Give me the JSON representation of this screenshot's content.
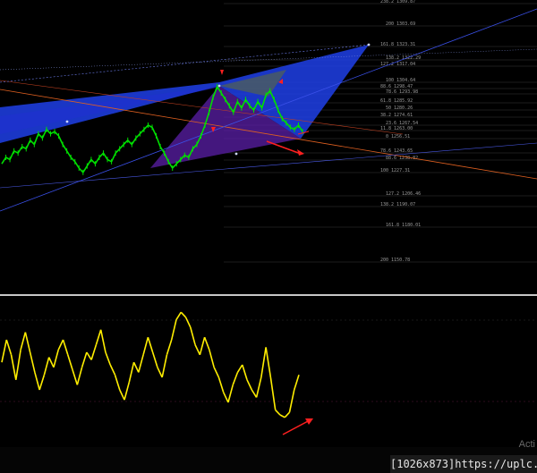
{
  "chart_data": [
    {
      "type": "line",
      "title": "",
      "xlabel": "",
      "ylabel": "",
      "ylim": [
        1140,
        1330
      ],
      "grid": false,
      "fib_levels": [
        {
          "label": "238.2 1309.87",
          "price": 1309.87
        },
        {
          "label": "200 1303.69",
          "price": 1303.69
        },
        {
          "label": "161.8 1323.31",
          "price": 1323.31
        },
        {
          "label": "138.2 1322.29",
          "price": 1322.29
        },
        {
          "label": "127.2 1317.04",
          "price": 1317.04
        },
        {
          "label": "100 1304.64",
          "price": 1304.64
        },
        {
          "label": "88.6 1298.47",
          "price": 1298.47
        },
        {
          "label": "78.6 1293.98",
          "price": 1293.98
        },
        {
          "label": "61.8 1285.92",
          "price": 1285.92
        },
        {
          "label": "50 1280.26",
          "price": 1280.26
        },
        {
          "label": "38.2 1274.61",
          "price": 1274.61
        },
        {
          "label": "23.6 1267.54",
          "price": 1267.54
        },
        {
          "label": "11.8 1263.00",
          "price": 1263.0
        },
        {
          "label": "0 1256.51",
          "price": 1256.51
        },
        {
          "label": "78.6 1243.65",
          "price": 1243.65
        },
        {
          "label": "88.6 1238.82",
          "price": 1238.82
        },
        {
          "label": "100 1227.31",
          "price": 1227.31
        },
        {
          "label": "127.2 1206.46",
          "price": 1206.46
        },
        {
          "label": "138.2 1190.07",
          "price": 1190.07
        },
        {
          "label": "161.8 1180.01",
          "price": 1180.01
        },
        {
          "label": "200 1150.78",
          "price": 1150.78
        }
      ],
      "series": [
        {
          "values": [
            1234,
            1240,
            1238,
            1246,
            1244,
            1250,
            1248,
            1256,
            1252,
            1262,
            1258,
            1266,
            1262,
            1264,
            1260,
            1252,
            1246,
            1240,
            1236,
            1230,
            1226,
            1232,
            1238,
            1234,
            1240,
            1244,
            1238,
            1236,
            1244,
            1248,
            1252,
            1256,
            1252,
            1258,
            1262,
            1266,
            1270,
            1268,
            1260,
            1250,
            1244,
            1236,
            1230,
            1234,
            1238,
            1242,
            1240,
            1248,
            1252,
            1260,
            1270,
            1282,
            1296,
            1306,
            1300,
            1294,
            1288,
            1282,
            1292,
            1286,
            1294,
            1288,
            1284,
            1292,
            1286,
            1298,
            1302,
            1294,
            1284,
            1276,
            1272,
            1268,
            1266,
            1270,
            1264
          ]
        }
      ],
      "colors": {
        "price": "#00e000",
        "fan_blue": "#2d3fe6",
        "triangle": "#5a1fa3",
        "arrow": "#ff2020"
      }
    },
    {
      "type": "line",
      "title": "",
      "series": [
        {
          "values": [
            52,
            70,
            58,
            38,
            62,
            76,
            60,
            44,
            30,
            42,
            56,
            48,
            62,
            70,
            58,
            46,
            34,
            48,
            60,
            54,
            66,
            78,
            60,
            50,
            42,
            30,
            22,
            36,
            52,
            44,
            58,
            72,
            60,
            48,
            40,
            58,
            70,
            86,
            92,
            88,
            80,
            66,
            58,
            72,
            62,
            48,
            40,
            28,
            20,
            34,
            44,
            50,
            38,
            30,
            24,
            40,
            64,
            40,
            14,
            10,
            8,
            12,
            30,
            42
          ]
        }
      ],
      "ylim": [
        0,
        100
      ],
      "colors": {
        "line": "#ffee00",
        "arrow": "#ff2020"
      }
    }
  ],
  "watermark": "Acti",
  "footer_text": "[1026x873]https://uplc.me/"
}
